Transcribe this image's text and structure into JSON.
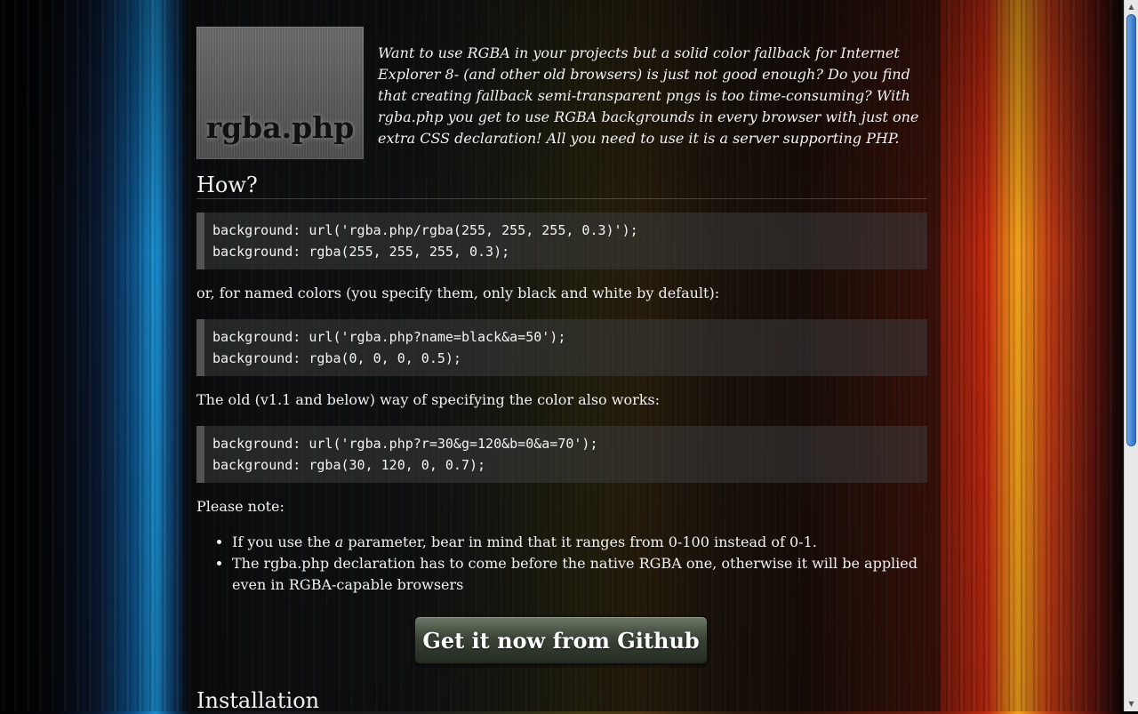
{
  "logo": {
    "text": "rgba.php"
  },
  "intro": "Want to use RGBA in your projects but a solid color fallback for Internet Explorer 8- (and other old browsers) is just not good enough? Do you find that creating fallback semi-transparent pngs is too time-consuming? With rgba.php you get to use RGBA backgrounds in every browser with just one extra CSS declaration! All you need to use it is a server supporting PHP.",
  "how": {
    "heading": "How?",
    "code1": [
      "background: url('rgba.php/rgba(255, 255, 255, 0.3)');",
      "background: rgba(255, 255, 255, 0.3);"
    ],
    "named_text": "or, for named colors (you specify them, only black and white by default):",
    "code2": [
      "background: url('rgba.php?name=black&a=50');",
      "background: rgba(0, 0, 0, 0.5);"
    ],
    "old_text": "The old (v1.1 and below) way of specifying the color also works:",
    "code3": [
      "background: url('rgba.php?r=30&g=120&b=0&a=70');",
      "background: rgba(30, 120, 0, 0.7);"
    ],
    "note_label": "Please note:",
    "notes": {
      "n1_before": "If you use the ",
      "n1_em": "a",
      "n1_after": " parameter, bear in mind that it ranges from 0-100 instead of 0-1.",
      "n2": "The rgba.php declaration has to come before the native RGBA one, otherwise it will be applied even in RGBA-capable browsers"
    }
  },
  "cta": {
    "label": "Get it now from Github"
  },
  "installation": {
    "heading": "Installation"
  },
  "scrollbar": {
    "up_icon": "▲",
    "down_icon": "▼"
  }
}
